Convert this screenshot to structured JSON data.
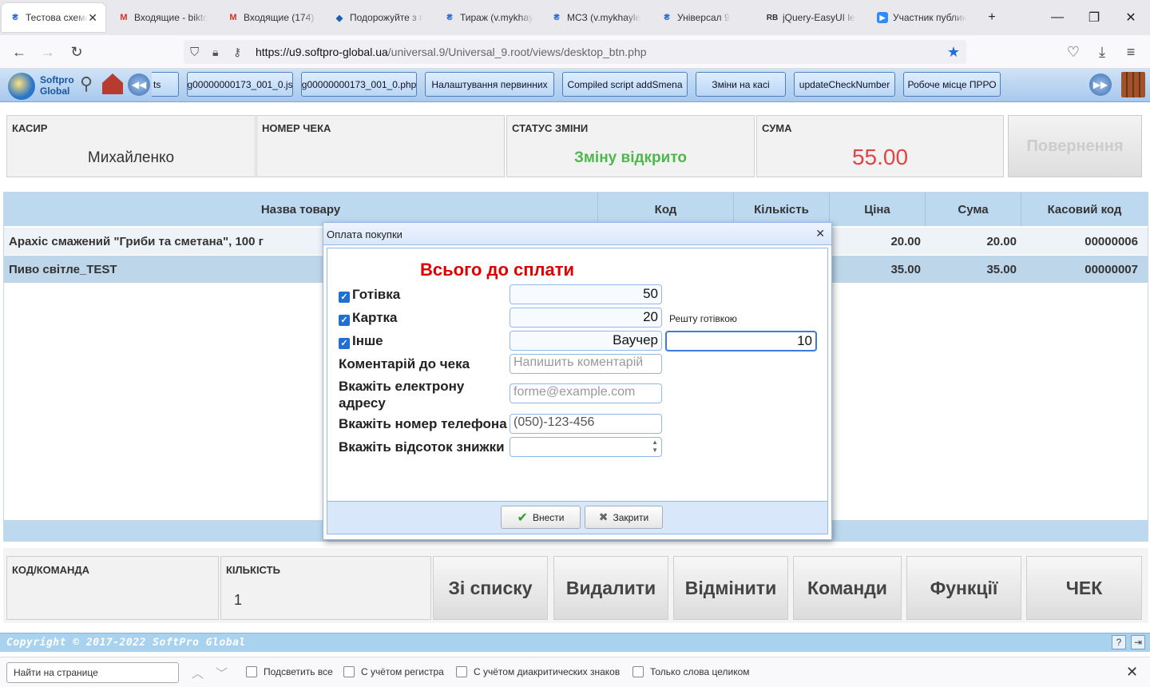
{
  "browser": {
    "tabs": [
      {
        "title": "Тестова схема",
        "icon": "uah-icon"
      },
      {
        "title": "Входящие - bikto",
        "icon": "gmail-icon"
      },
      {
        "title": "Входящие (174) -",
        "icon": "gmail-icon"
      },
      {
        "title": "Подорожуйте з п",
        "icon": "bookmark-icon"
      },
      {
        "title": "Тираж (v.mykhay",
        "icon": "uah-icon"
      },
      {
        "title": "МСЗ (v.mykhayle",
        "icon": "uah-icon"
      },
      {
        "title": "Універсал 9",
        "icon": "uah-icon"
      },
      {
        "title": "jQuery-EasyUI lea",
        "icon": "rb-icon"
      },
      {
        "title": "Участник публик",
        "icon": "zoom-icon"
      }
    ],
    "url_domain": "https://u9.softpro-global.ua",
    "url_path": "/universal.9/Universal_9.root/views/desktop_btn.php"
  },
  "toolbar": {
    "logo_line1": "Softpro",
    "logo_line2": "Global",
    "buttons": [
      "ts",
      "g00000000173_001_0.js",
      "g00000000173_001_0.php",
      "Налаштування первинних",
      "Compiled script addSmena",
      "Зміни на касі",
      "updateCheckNumber",
      "Робоче місце ПРРО"
    ]
  },
  "info": {
    "cashier_label": "КАСИР",
    "cashier_value": "Михайленко",
    "check_label": "НОМЕР ЧЕКА",
    "check_value": "",
    "shift_label": "СТАТУС ЗМІНИ",
    "shift_value": "Зміну відкрито",
    "sum_label": "СУМА",
    "sum_value": "55.00",
    "return_label": "Повернення"
  },
  "grid": {
    "headers": [
      "Назва товару",
      "Код",
      "Кількість",
      "Ціна",
      "Сума",
      "Касовий код"
    ],
    "rows": [
      {
        "name": "Арахіс смажений \"Гриби та сметана\", 100 г",
        "price": "20.00",
        "sum": "20.00",
        "cash_code": "00000006"
      },
      {
        "name": "Пиво світле_TEST",
        "price": "35.00",
        "sum": "35.00",
        "cash_code": "00000007"
      }
    ]
  },
  "bottom": {
    "code_label": "КОД/КОМАНДА",
    "qty_label": "КІЛЬКІСТЬ",
    "qty_value": "1",
    "buttons": [
      "Зі списку",
      "Видалити",
      "Відмінити",
      "Команди",
      "Функції",
      "ЧЕК"
    ]
  },
  "footer": {
    "copyright": "Copyright © 2017-2022 SoftPro Global"
  },
  "findbar": {
    "placeholder": "Найти на странице",
    "options": [
      "Подсветить все",
      "С учётом регистра",
      "С учётом диакритических знаков",
      "Только слова целиком"
    ]
  },
  "dialog": {
    "title": "Оплата покупки",
    "total_label": "Всього до сплати",
    "cash_label": "Готівка",
    "cash_value": "50",
    "card_label": "Картка",
    "card_value": "20",
    "change_note": "Решту готівкою",
    "other_label": "Інше",
    "other_type": "Ваучер",
    "other_value": "10",
    "comment_label": "Коментарій до чека",
    "comment_placeholder": "Напишить коментарій",
    "email_label_1": "Вкажіть електрону",
    "email_label_2": "адресу",
    "email_placeholder": "forme@example.com",
    "phone_label": "Вкажіть номер телефона",
    "phone_placeholder": "(050)-123-456",
    "discount_label": "Вкажіть відсоток знижки",
    "submit_label": "Внести",
    "close_label": "Закрити"
  }
}
